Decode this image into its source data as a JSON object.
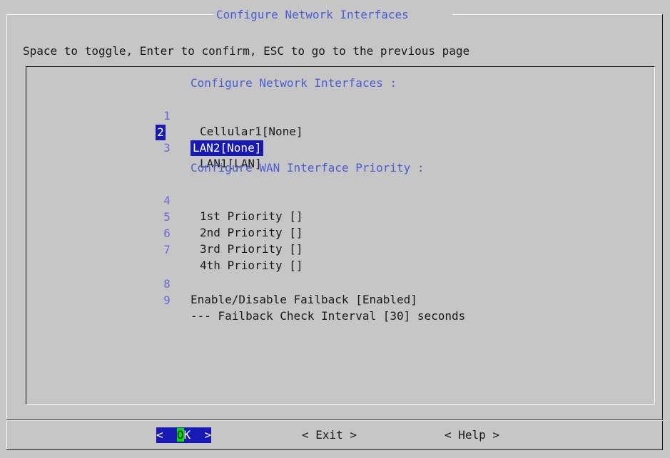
{
  "dialog": {
    "title": "Configure Network Interfaces",
    "instructions": "Space to toggle, Enter to confirm, ESC to go to the previous page"
  },
  "list": {
    "section1_heading": "Configure Network Interfaces :",
    "section2_heading": "Configure WAN Interface Priority :",
    "items": [
      {
        "num": "1",
        "label": "Cellular1[None]"
      },
      {
        "num": "2",
        "label": "LAN2[None]",
        "selected": true
      },
      {
        "num": "3",
        "label": "LAN1[LAN]"
      },
      {
        "num": "4",
        "label": "1st Priority []"
      },
      {
        "num": "5",
        "label": "2nd Priority []"
      },
      {
        "num": "6",
        "label": "3rd Priority []"
      },
      {
        "num": "7",
        "label": "4th Priority []"
      },
      {
        "num": "8",
        "label": "Enable/Disable Failback [Enabled]"
      },
      {
        "num": "9",
        "label": "--- Failback Check Interval [30] seconds"
      }
    ]
  },
  "buttons": {
    "ok": {
      "left": "<  ",
      "hotkey": "O",
      "rest": "K  >"
    },
    "exit": "< Exit >",
    "help": "< Help >"
  },
  "colors": {
    "background": "#c6c6c6",
    "selection": "#1818b4",
    "heading": "#4a5cd6",
    "hotkey": "#00e000"
  }
}
